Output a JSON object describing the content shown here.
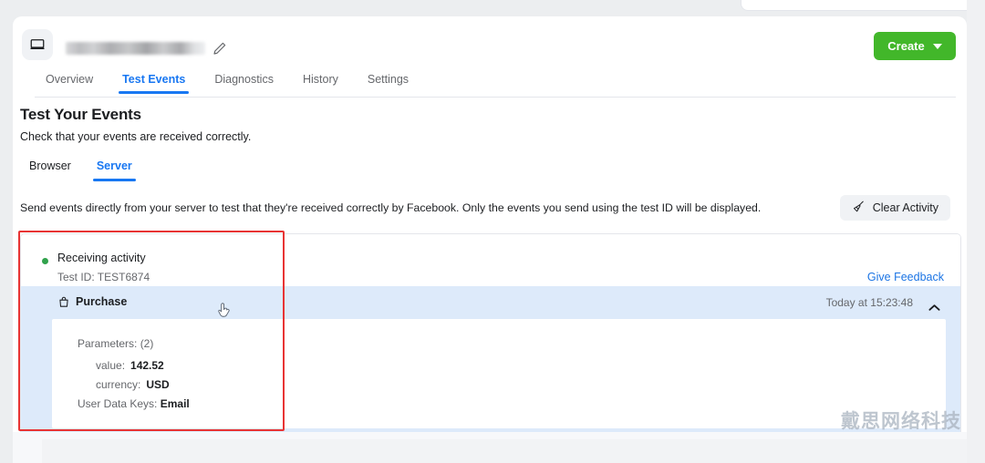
{
  "header": {
    "asset_icon": "monitor-icon",
    "asset_name_redacted": "",
    "edit_icon": "pencil-icon",
    "create_button": "Create"
  },
  "nav_tabs": [
    {
      "label": "Overview",
      "active": false
    },
    {
      "label": "Test Events",
      "active": true
    },
    {
      "label": "Diagnostics",
      "active": false
    },
    {
      "label": "History",
      "active": false
    },
    {
      "label": "Settings",
      "active": false
    }
  ],
  "page": {
    "title": "Test Your Events",
    "subtitle": "Check that your events are received correctly.",
    "description": "Send events directly from your server to test that they're received correctly by Facebook. Only the events you send using the test ID will be displayed."
  },
  "sub_tabs": [
    {
      "label": "Browser",
      "active": false
    },
    {
      "label": "Server",
      "active": true
    }
  ],
  "toolbar": {
    "clear_activity_label": "Clear Activity",
    "clear_activity_icon": "broom-icon"
  },
  "activity": {
    "status_label": "Receiving activity",
    "status_color": "#31a24c",
    "test_id": "Test ID: TEST6874",
    "give_feedback": "Give Feedback",
    "event": {
      "icon": "shopping-bag-icon",
      "name": "Purchase",
      "time": "Today at 15:23:48",
      "collapse_icon": "chevron-up-icon",
      "parameters_label": "Parameters: (2)",
      "parameters": [
        {
          "key": "value:",
          "value": "142.52"
        },
        {
          "key": "currency:",
          "value": "USD"
        }
      ],
      "user_data_keys_label": "User Data Keys:",
      "user_data_keys_value": "Email"
    }
  },
  "annotation": {
    "highlight_color": "#e83434"
  },
  "watermark": {
    "text": "戴思网络科技"
  },
  "theme": {
    "accent_blue": "#1877f2",
    "create_green": "#42b72a",
    "row_highlight": "#ddeafa"
  }
}
